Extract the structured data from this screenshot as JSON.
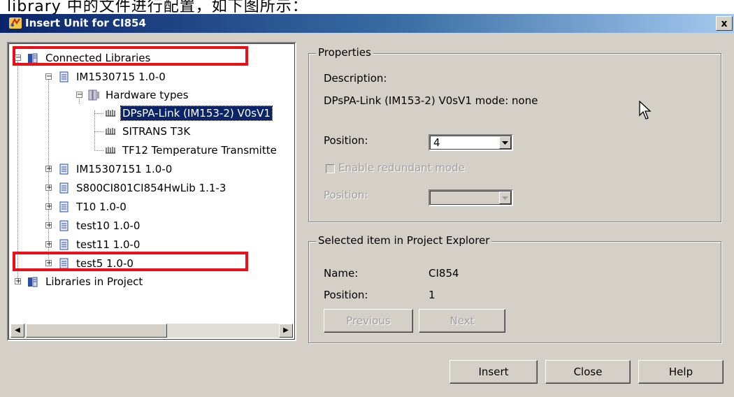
{
  "background_caption": "library 中的文件进行配置，如下图所示：",
  "window": {
    "title": "Insert Unit for CI854",
    "close_label": "x"
  },
  "tree": {
    "nodes": [
      {
        "label": "Connected Libraries"
      },
      {
        "label": "IM1530715 1.0-0"
      },
      {
        "label": "Hardware types"
      },
      {
        "label": "DPsPA-Link (IM153-2) V0sV1"
      },
      {
        "label": "SITRANS T3K"
      },
      {
        "label": "TF12 Temperature Transmitte"
      },
      {
        "label": "IM15307151 1.0-0"
      },
      {
        "label": "S800CI801CI854HwLib 1.1-3"
      },
      {
        "label": "T10 1.0-0"
      },
      {
        "label": "test10 1.0-0"
      },
      {
        "label": "test11 1.0-0"
      },
      {
        "label": "test5 1.0-0"
      },
      {
        "label": "Libraries in Project"
      }
    ],
    "highlighted": [
      "Connected Libraries",
      "test5 1.0-0"
    ],
    "highlight_color": "#e8111a"
  },
  "properties": {
    "title": "Properties",
    "description_label": "Description:",
    "description_value": "DPsPA-Link (IM153-2) V0sV1 mode: none",
    "position_label": "Position:",
    "position_value": "4",
    "redundant_label": "Enable redundant mode",
    "redundant_position_label": "Position:",
    "redundant_position_value": ""
  },
  "selected_item": {
    "title": "Selected item in Project Explorer",
    "name_label": "Name:",
    "name_value": "CI854",
    "position_label": "Position:",
    "position_value": "1",
    "previous_label": "Previous",
    "next_label": "Next"
  },
  "buttons": {
    "insert": "Insert",
    "close": "Close",
    "help": "Help"
  },
  "colors": {
    "titlebar_start": "#0a246a",
    "titlebar_end": "#a6caf0",
    "selection": "#0a246a",
    "dialog_bg": "#d4d0c8"
  }
}
